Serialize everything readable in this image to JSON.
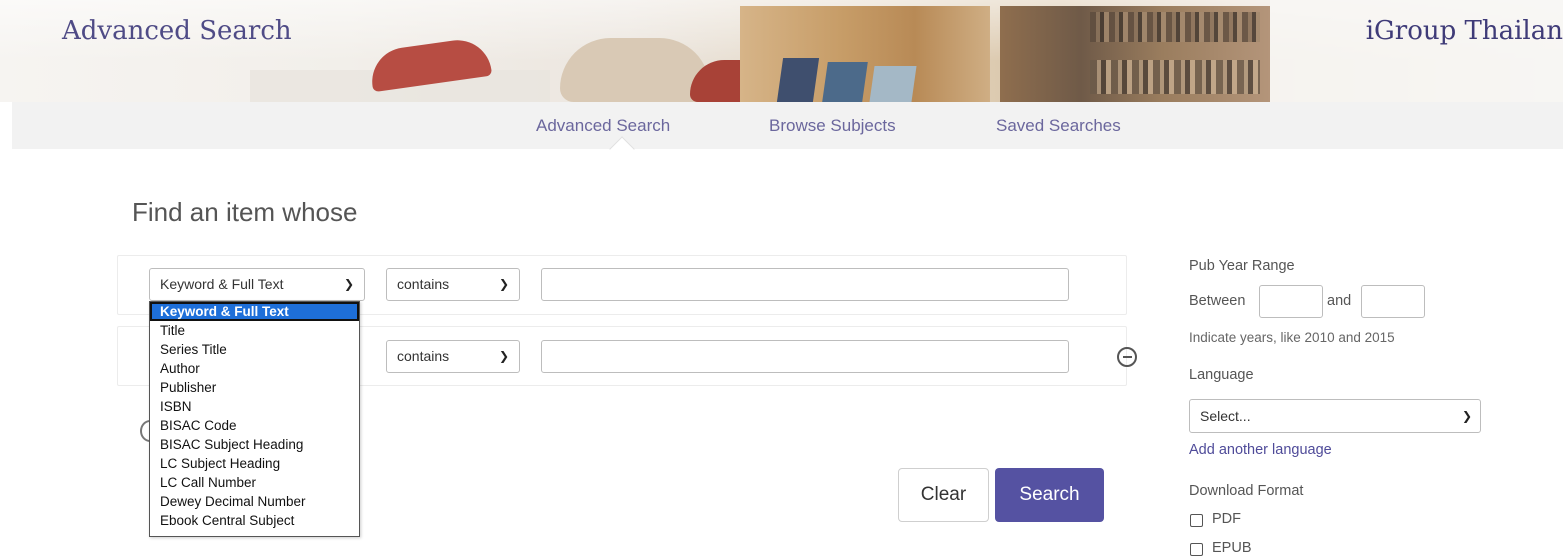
{
  "header": {
    "title": "Advanced Search",
    "brand": "iGroup Thailan"
  },
  "nav": {
    "items": [
      {
        "label": "Advanced Search",
        "active": true
      },
      {
        "label": "Browse Subjects"
      },
      {
        "label": "Saved Searches"
      }
    ]
  },
  "main": {
    "heading": "Find an item whose",
    "rows": [
      {
        "field": "Keyword & Full Text",
        "operator": "contains",
        "value": ""
      },
      {
        "field": "",
        "operator": "contains",
        "value": ""
      }
    ],
    "field_options": [
      "Keyword & Full Text",
      "Title",
      "Series Title",
      "Author",
      "Publisher",
      "ISBN",
      "BISAC Code",
      "BISAC Subject Heading",
      "LC Subject Heading",
      "LC Call Number",
      "Dewey Decimal Number",
      "Ebook Central Subject"
    ],
    "selected_option": "Keyword & Full Text",
    "clear_label": "Clear",
    "search_label": "Search"
  },
  "filters": {
    "pub_year_label": "Pub Year Range",
    "between_label": "Between",
    "and_label": "and",
    "year_hint": "Indicate years, like 2010 and 2015",
    "language_label": "Language",
    "language_select": "Select...",
    "add_language": "Add another language",
    "download_format_label": "Download Format",
    "formats": [
      "PDF",
      "EPUB"
    ]
  },
  "colors": {
    "accent": "#5552a2",
    "nav_text": "#6b679d",
    "highlight": "#1e6fd9"
  },
  "icons": [
    "chevron-down-icon",
    "remove-circle-icon",
    "add-circle-icon"
  ]
}
